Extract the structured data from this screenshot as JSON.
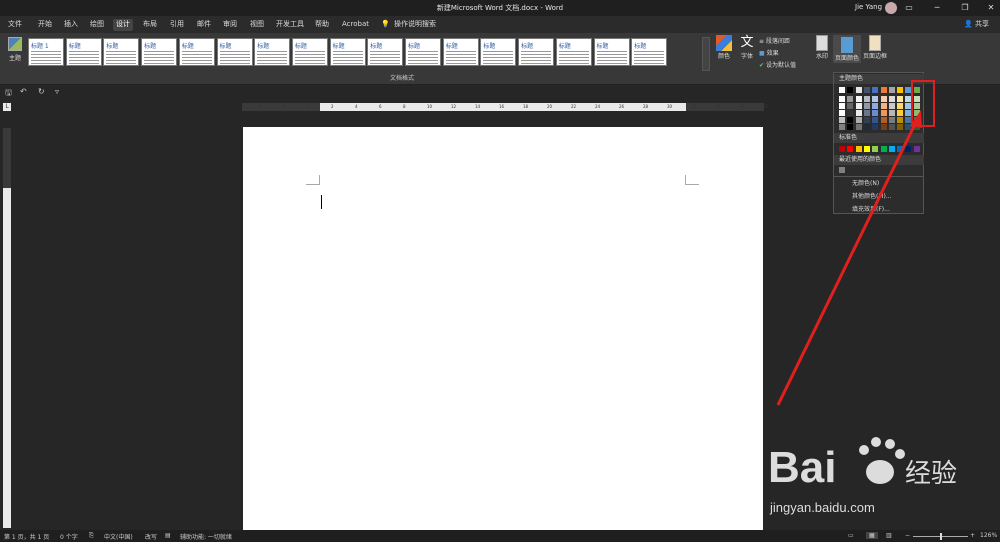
{
  "window": {
    "title": "新建Microsoft Word 文档.docx - Word",
    "user": "Jie Yang"
  },
  "tabs": [
    "文件",
    "开始",
    "插入",
    "绘图",
    "设计",
    "布局",
    "引用",
    "邮件",
    "审阅",
    "视图",
    "开发工具",
    "帮助",
    "Acrobat"
  ],
  "active_tab": "设计",
  "tell_me": "操作说明搜索",
  "share": "共享",
  "ribbon": {
    "themes": "主题",
    "section_label": "文档格式",
    "style_thumbs": [
      {
        "title": "标题 1"
      },
      {
        "title": "标题"
      },
      {
        "title": "标题"
      },
      {
        "title": "标题"
      },
      {
        "title": "标题"
      },
      {
        "title": "标题"
      },
      {
        "title": "标题"
      },
      {
        "title": "标题"
      },
      {
        "title": "标题"
      },
      {
        "title": "标题"
      },
      {
        "title": "标题"
      },
      {
        "title": "标题"
      },
      {
        "title": "标题"
      },
      {
        "title": "标题"
      },
      {
        "title": "标题"
      },
      {
        "title": "标题"
      },
      {
        "title": "标题"
      }
    ],
    "colors": "颜色",
    "fonts": "字体",
    "fonts_glyph": "文",
    "paragraph_spacing": "段落间距",
    "effects": "效果",
    "set_default": "设为默认值",
    "watermark": "水印",
    "page_color": "页面颜色",
    "page_borders": "页面边框"
  },
  "qat": {
    "save": "🖫",
    "undo": "↶",
    "redo": "↻",
    "customize": "▿"
  },
  "ruler": {
    "corner": "L",
    "ticks": [
      "6",
      "4",
      "2",
      "2",
      "4",
      "6",
      "8",
      "10",
      "12",
      "14",
      "16",
      "18",
      "20",
      "22",
      "24",
      "26",
      "28",
      "30",
      "32",
      "34",
      "36",
      "38"
    ]
  },
  "dropdown": {
    "theme_colors_header": "主题颜色",
    "standard_colors_header": "标准色",
    "recent_colors_header": "最近使用的颜色",
    "no_color": "无颜色(N)",
    "more_colors": "其他颜色(M)...",
    "fill_effects": "填充效果(F)...",
    "theme_top": [
      "#ffffff",
      "#000000",
      "#e7e6e6",
      "#44546a",
      "#4472c4",
      "#ed7d31",
      "#a5a5a5",
      "#ffc000",
      "#5b9bd5",
      "#70ad47"
    ],
    "standard": [
      "#c00000",
      "#ff0000",
      "#ffc000",
      "#ffff00",
      "#92d050",
      "#00b050",
      "#00b0f0",
      "#0070c0",
      "#002060",
      "#7030a0"
    ],
    "recent": [
      "#808080"
    ]
  },
  "status": {
    "page": "第 1 页，共 1 页",
    "words": "0 个字",
    "language": "中文(中国)",
    "insert": "改写",
    "accessibility": "辅助功能: 一切就绪",
    "zoom": "126%"
  },
  "watermark": {
    "brand": "Bai",
    "brand2": "经验",
    "url": "jingyan.baidu.com"
  }
}
